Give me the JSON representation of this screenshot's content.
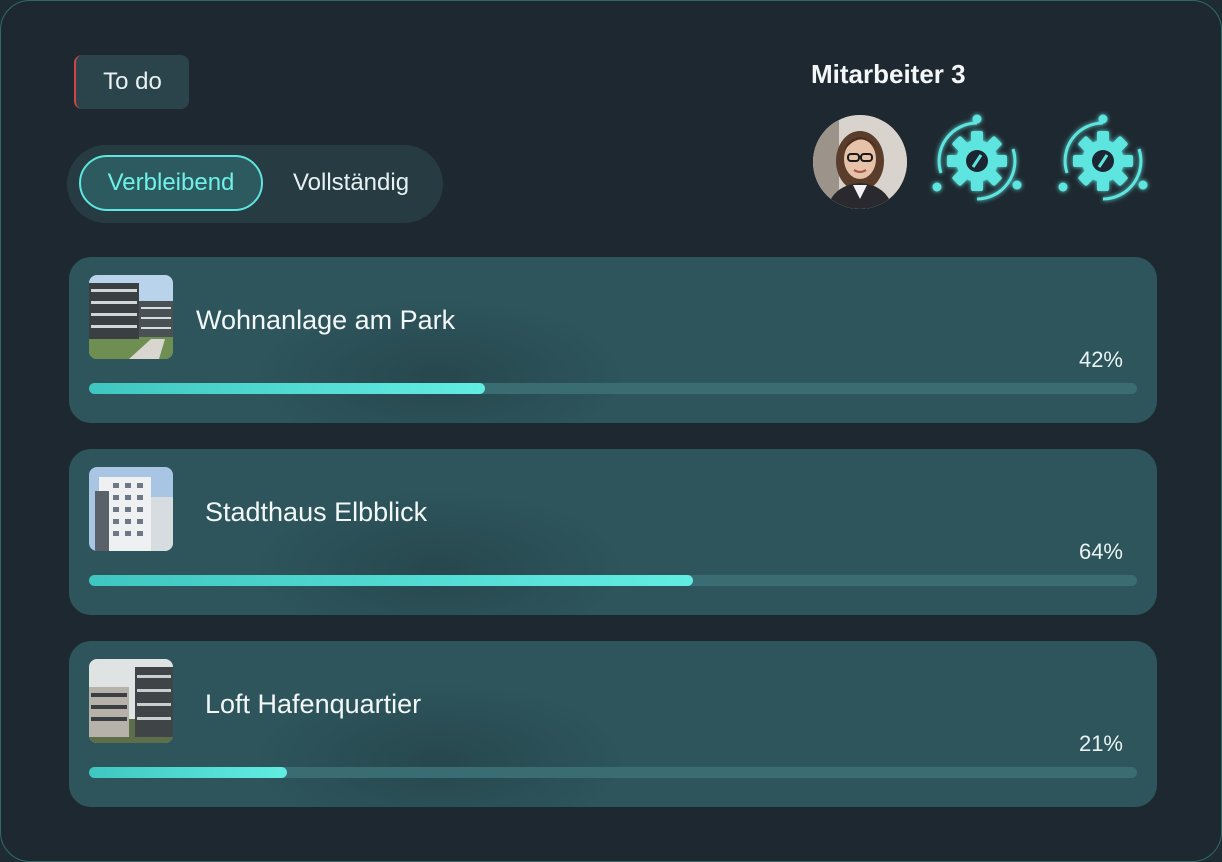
{
  "header": {
    "todo_label": "To do",
    "staff_title": "Mitarbeiter 3"
  },
  "filter": {
    "options": [
      "Verbleibend",
      "Vollständig"
    ],
    "selected": "Verbleibend"
  },
  "staff": {
    "members": [
      {
        "type": "photo",
        "icon": "avatar"
      },
      {
        "type": "bot",
        "icon": "gear-icon"
      },
      {
        "type": "bot",
        "icon": "gear-icon"
      }
    ]
  },
  "projects": [
    {
      "name": "Wohnanlage am Park",
      "percent_label": "42%",
      "progress": 42
    },
    {
      "name": "Stadthaus Elbblick",
      "percent_label": "64%",
      "progress": 64
    },
    {
      "name": "Loft Hafenquartier",
      "percent_label": "21%",
      "progress": 21
    }
  ],
  "colors": {
    "accent": "#5ee5df",
    "card": "#2e555c",
    "background": "#1e2830",
    "todo_marker": "#d14646"
  }
}
